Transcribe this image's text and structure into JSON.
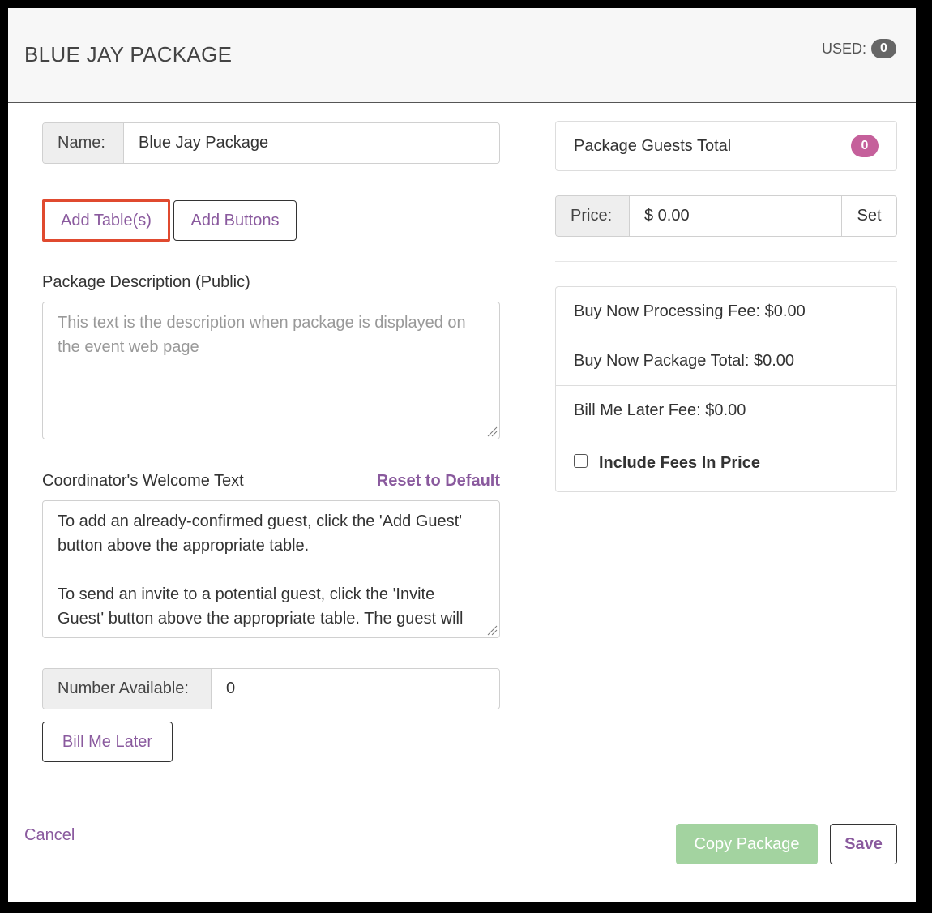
{
  "header": {
    "title": "BLUE JAY PACKAGE",
    "used_label": "USED:",
    "used_count": "0"
  },
  "form": {
    "name_label": "Name:",
    "name_value": "Blue Jay Package",
    "add_tables_label": "Add Table(s)",
    "add_buttons_label": "Add Buttons",
    "description_label": "Package Description (Public)",
    "description_placeholder": "This text is the description when package is displayed on the event web page",
    "welcome_label": "Coordinator's Welcome Text",
    "reset_label": "Reset to Default",
    "welcome_paragraph_1": "To add an already-confirmed guest, click the 'Add Guest' button above the appropriate table.",
    "welcome_paragraph_2": "To send an invite to a potential guest, click the 'Invite Guest' button above the appropriate table. The guest will",
    "number_available_label": "Number Available:",
    "number_available_value": "0",
    "bill_me_later_label": "Bill Me Later"
  },
  "summary": {
    "guests_total_label": "Package Guests Total",
    "guests_total_count": "0",
    "price_label": "Price:",
    "price_value": "$ 0.00",
    "set_label": "Set",
    "processing_fee": "Buy Now Processing Fee: $0.00",
    "package_total": "Buy Now Package Total: $0.00",
    "bill_later_fee": "Bill Me Later Fee: $0.00",
    "include_fees_label": "Include Fees In Price",
    "include_fees_checked": false
  },
  "footer": {
    "cancel_label": "Cancel",
    "copy_label": "Copy Package",
    "save_label": "Save"
  },
  "colors": {
    "accent_purple": "#8a5a9e",
    "badge_pink": "#c5609b",
    "highlight_red": "#e04a2f",
    "copy_green": "#a3d3a0"
  }
}
